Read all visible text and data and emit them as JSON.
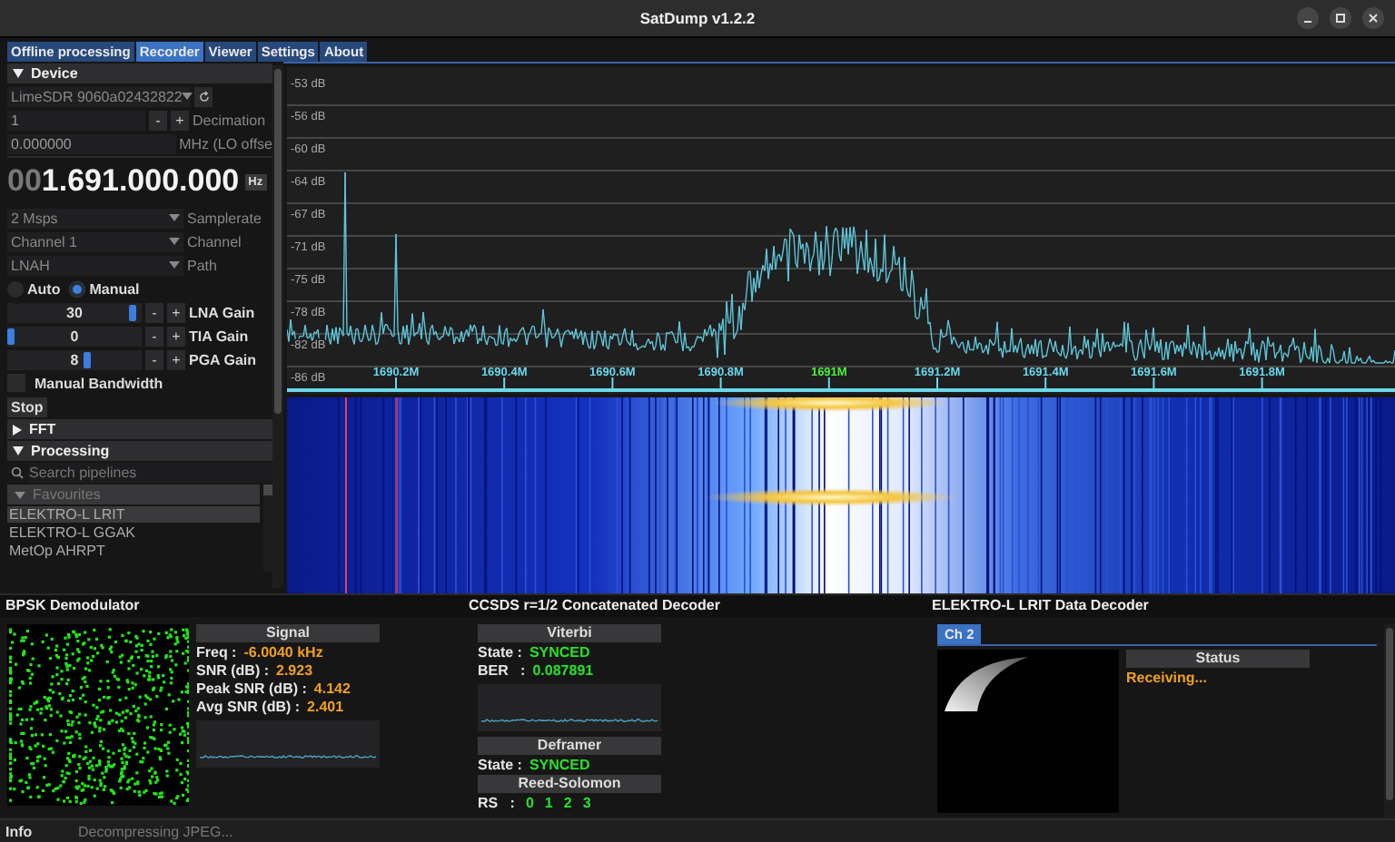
{
  "window": {
    "title": "SatDump v1.2.2"
  },
  "tabs": [
    {
      "label": "Offline processing",
      "selected": false
    },
    {
      "label": "Recorder",
      "selected": true
    },
    {
      "label": "Viewer",
      "selected": false
    },
    {
      "label": "Settings",
      "selected": false
    },
    {
      "label": "About",
      "selected": false
    }
  ],
  "sidebar": {
    "device": {
      "header": "Device",
      "expanded": true,
      "source": "LimeSDR 9060a02432822",
      "decimation": {
        "value": "1",
        "minus": "-",
        "plus": "+",
        "label": "Decimation"
      },
      "lo_offset": {
        "value": "0.000000",
        "label": "MHz (LO offse"
      },
      "frequency": {
        "leading": "00",
        "value": "1.691.000.000",
        "unit": "Hz"
      },
      "selects": [
        {
          "value": "2 Msps",
          "label": "Samplerate"
        },
        {
          "value": "Channel 1",
          "label": "Channel"
        },
        {
          "value": "LNAH",
          "label": "Path"
        }
      ],
      "gain_mode": [
        {
          "label": "Auto",
          "selected": false
        },
        {
          "label": "Manual",
          "selected": true
        }
      ],
      "gains": [
        {
          "value": "30",
          "level": 0.95,
          "minus": "-",
          "plus": "+",
          "label": "LNA Gain"
        },
        {
          "value": "0",
          "level": 0,
          "minus": "-",
          "plus": "+",
          "label": "TIA Gain"
        },
        {
          "value": "8",
          "level": 0.6,
          "minus": "-",
          "plus": "+",
          "label": "PGA Gain"
        }
      ],
      "manual_bandwidth": {
        "label": "Manual Bandwidth",
        "checked": false
      },
      "stop_button": "Stop"
    },
    "fft": {
      "header": "FFT",
      "expanded": false
    },
    "processing": {
      "header": "Processing",
      "expanded": true,
      "search_placeholder": "Search pipelines",
      "group": "Favourites",
      "pipelines": [
        {
          "label": "ELEKTRO-L LRIT",
          "selected": true
        },
        {
          "label": "ELEKTRO-L GGAK",
          "selected": false
        },
        {
          "label": "MetOp AHRPT",
          "selected": false
        }
      ]
    }
  },
  "spectrum": {
    "y_labels": [
      "-53 dB",
      "-56 dB",
      "-60 dB",
      "-64 dB",
      "-67 dB",
      "-71 dB",
      "-75 dB",
      "-78 dB",
      "-82 dB",
      "-86 dB"
    ],
    "x_labels": [
      {
        "text": "1690.2M",
        "highlight": false
      },
      {
        "text": "1690.4M",
        "highlight": false
      },
      {
        "text": "1690.6M",
        "highlight": false
      },
      {
        "text": "1690.8M",
        "highlight": false
      },
      {
        "text": "1691M",
        "highlight": true
      },
      {
        "text": "1691.2M",
        "highlight": false
      },
      {
        "text": "1691.4M",
        "highlight": false
      },
      {
        "text": "1691.6M",
        "highlight": false
      },
      {
        "text": "1691.8M",
        "highlight": false
      }
    ]
  },
  "demodulator": {
    "title": "BPSK Demodulator",
    "signal": {
      "header": "Signal",
      "rows": [
        {
          "label": "Freq :",
          "value": "-6.0040 kHz"
        },
        {
          "label": "SNR (dB) :",
          "value": "2.923"
        },
        {
          "label": "Peak SNR (dB) :",
          "value": "4.142"
        },
        {
          "label": "Avg SNR (dB) :",
          "value": "2.401"
        }
      ]
    }
  },
  "decoder": {
    "title": "CCSDS r=1/2 Concatenated Decoder",
    "viterbi": {
      "header": "Viterbi",
      "rows": [
        {
          "label": "State :",
          "value": "SYNCED"
        },
        {
          "label": "BER   :",
          "value": "0.087891"
        }
      ]
    },
    "deframer": {
      "header": "Deframer",
      "rows": [
        {
          "label": "State :",
          "value": "SYNCED"
        }
      ]
    },
    "reed_solomon": {
      "header": "Reed-Solomon",
      "label": "RS   :",
      "values": [
        "0",
        "1",
        "2",
        "3"
      ]
    }
  },
  "data_decoder": {
    "title": "ELEKTRO-L LRIT Data Decoder",
    "tabs": [
      {
        "label": "Ch 2",
        "selected": true
      }
    ],
    "status": {
      "header": "Status",
      "value": "Receiving..."
    }
  },
  "status_bar": {
    "label": "Info",
    "message": "Decompressing JPEG..."
  }
}
